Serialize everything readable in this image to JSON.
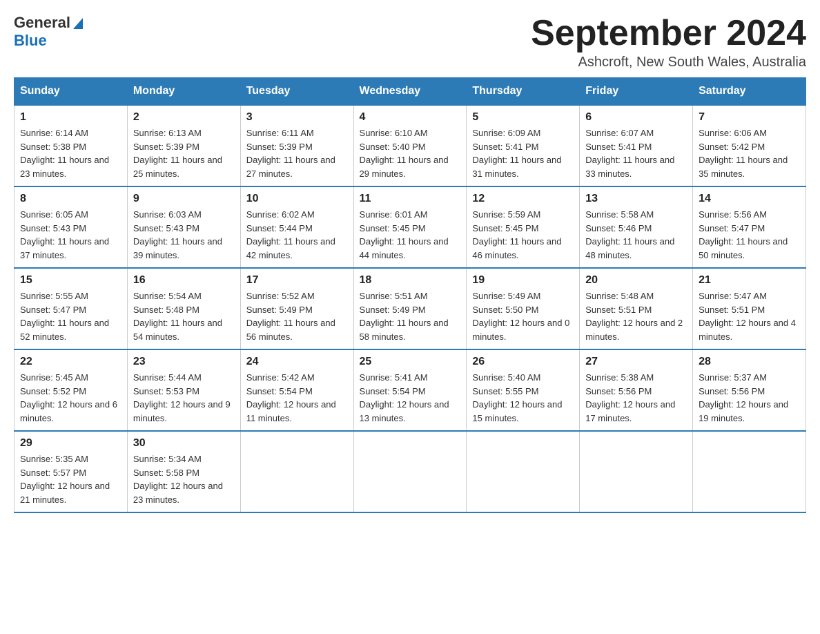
{
  "header": {
    "logo_general": "General",
    "logo_blue": "Blue",
    "month_title": "September 2024",
    "location": "Ashcroft, New South Wales, Australia"
  },
  "weekdays": [
    "Sunday",
    "Monday",
    "Tuesday",
    "Wednesday",
    "Thursday",
    "Friday",
    "Saturday"
  ],
  "weeks": [
    [
      {
        "day": "1",
        "sunrise": "6:14 AM",
        "sunset": "5:38 PM",
        "daylight": "11 hours and 23 minutes."
      },
      {
        "day": "2",
        "sunrise": "6:13 AM",
        "sunset": "5:39 PM",
        "daylight": "11 hours and 25 minutes."
      },
      {
        "day": "3",
        "sunrise": "6:11 AM",
        "sunset": "5:39 PM",
        "daylight": "11 hours and 27 minutes."
      },
      {
        "day": "4",
        "sunrise": "6:10 AM",
        "sunset": "5:40 PM",
        "daylight": "11 hours and 29 minutes."
      },
      {
        "day": "5",
        "sunrise": "6:09 AM",
        "sunset": "5:41 PM",
        "daylight": "11 hours and 31 minutes."
      },
      {
        "day": "6",
        "sunrise": "6:07 AM",
        "sunset": "5:41 PM",
        "daylight": "11 hours and 33 minutes."
      },
      {
        "day": "7",
        "sunrise": "6:06 AM",
        "sunset": "5:42 PM",
        "daylight": "11 hours and 35 minutes."
      }
    ],
    [
      {
        "day": "8",
        "sunrise": "6:05 AM",
        "sunset": "5:43 PM",
        "daylight": "11 hours and 37 minutes."
      },
      {
        "day": "9",
        "sunrise": "6:03 AM",
        "sunset": "5:43 PM",
        "daylight": "11 hours and 39 minutes."
      },
      {
        "day": "10",
        "sunrise": "6:02 AM",
        "sunset": "5:44 PM",
        "daylight": "11 hours and 42 minutes."
      },
      {
        "day": "11",
        "sunrise": "6:01 AM",
        "sunset": "5:45 PM",
        "daylight": "11 hours and 44 minutes."
      },
      {
        "day": "12",
        "sunrise": "5:59 AM",
        "sunset": "5:45 PM",
        "daylight": "11 hours and 46 minutes."
      },
      {
        "day": "13",
        "sunrise": "5:58 AM",
        "sunset": "5:46 PM",
        "daylight": "11 hours and 48 minutes."
      },
      {
        "day": "14",
        "sunrise": "5:56 AM",
        "sunset": "5:47 PM",
        "daylight": "11 hours and 50 minutes."
      }
    ],
    [
      {
        "day": "15",
        "sunrise": "5:55 AM",
        "sunset": "5:47 PM",
        "daylight": "11 hours and 52 minutes."
      },
      {
        "day": "16",
        "sunrise": "5:54 AM",
        "sunset": "5:48 PM",
        "daylight": "11 hours and 54 minutes."
      },
      {
        "day": "17",
        "sunrise": "5:52 AM",
        "sunset": "5:49 PM",
        "daylight": "11 hours and 56 minutes."
      },
      {
        "day": "18",
        "sunrise": "5:51 AM",
        "sunset": "5:49 PM",
        "daylight": "11 hours and 58 minutes."
      },
      {
        "day": "19",
        "sunrise": "5:49 AM",
        "sunset": "5:50 PM",
        "daylight": "12 hours and 0 minutes."
      },
      {
        "day": "20",
        "sunrise": "5:48 AM",
        "sunset": "5:51 PM",
        "daylight": "12 hours and 2 minutes."
      },
      {
        "day": "21",
        "sunrise": "5:47 AM",
        "sunset": "5:51 PM",
        "daylight": "12 hours and 4 minutes."
      }
    ],
    [
      {
        "day": "22",
        "sunrise": "5:45 AM",
        "sunset": "5:52 PM",
        "daylight": "12 hours and 6 minutes."
      },
      {
        "day": "23",
        "sunrise": "5:44 AM",
        "sunset": "5:53 PM",
        "daylight": "12 hours and 9 minutes."
      },
      {
        "day": "24",
        "sunrise": "5:42 AM",
        "sunset": "5:54 PM",
        "daylight": "12 hours and 11 minutes."
      },
      {
        "day": "25",
        "sunrise": "5:41 AM",
        "sunset": "5:54 PM",
        "daylight": "12 hours and 13 minutes."
      },
      {
        "day": "26",
        "sunrise": "5:40 AM",
        "sunset": "5:55 PM",
        "daylight": "12 hours and 15 minutes."
      },
      {
        "day": "27",
        "sunrise": "5:38 AM",
        "sunset": "5:56 PM",
        "daylight": "12 hours and 17 minutes."
      },
      {
        "day": "28",
        "sunrise": "5:37 AM",
        "sunset": "5:56 PM",
        "daylight": "12 hours and 19 minutes."
      }
    ],
    [
      {
        "day": "29",
        "sunrise": "5:35 AM",
        "sunset": "5:57 PM",
        "daylight": "12 hours and 21 minutes."
      },
      {
        "day": "30",
        "sunrise": "5:34 AM",
        "sunset": "5:58 PM",
        "daylight": "12 hours and 23 minutes."
      },
      null,
      null,
      null,
      null,
      null
    ]
  ]
}
